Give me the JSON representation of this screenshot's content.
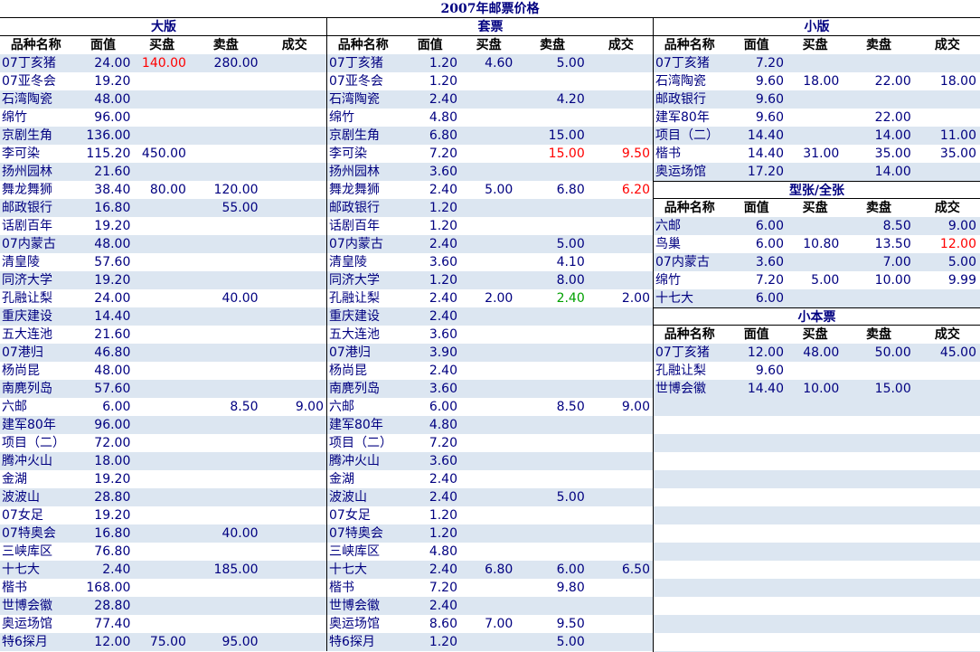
{
  "title": "2007年邮票价格",
  "headers": [
    "品种名称",
    "面值",
    "买盘",
    "卖盘",
    "成交"
  ],
  "sections": {
    "daban": {
      "title": "大版",
      "rows": [
        [
          "07丁亥猪",
          "24.00",
          "140.00",
          "280.00",
          ""
        ],
        [
          "07亚冬会",
          "19.20",
          "",
          "",
          ""
        ],
        [
          "石湾陶瓷",
          "48.00",
          "",
          "",
          ""
        ],
        [
          "绵竹",
          "96.00",
          "",
          "",
          ""
        ],
        [
          "京剧生角",
          "136.00",
          "",
          "",
          ""
        ],
        [
          "李可染",
          "115.20",
          "450.00",
          "",
          ""
        ],
        [
          "扬州园林",
          "21.60",
          "",
          "",
          ""
        ],
        [
          "舞龙舞狮",
          "38.40",
          "80.00",
          "120.00",
          ""
        ],
        [
          "邮政银行",
          "16.80",
          "",
          "55.00",
          ""
        ],
        [
          "话剧百年",
          "19.20",
          "",
          "",
          ""
        ],
        [
          "07内蒙古",
          "48.00",
          "",
          "",
          ""
        ],
        [
          "清皇陵",
          "57.60",
          "",
          "",
          ""
        ],
        [
          "同济大学",
          "19.20",
          "",
          "",
          ""
        ],
        [
          "孔融让梨",
          "24.00",
          "",
          "40.00",
          ""
        ],
        [
          "重庆建设",
          "14.40",
          "",
          "",
          ""
        ],
        [
          "五大连池",
          "21.60",
          "",
          "",
          ""
        ],
        [
          "07港归",
          "46.80",
          "",
          "",
          ""
        ],
        [
          "杨尚昆",
          "48.00",
          "",
          "",
          ""
        ],
        [
          "南麂列岛",
          "57.60",
          "",
          "",
          ""
        ],
        [
          "六邮",
          "6.00",
          "",
          "8.50",
          "9.00"
        ],
        [
          "建军80年",
          "96.00",
          "",
          "",
          ""
        ],
        [
          "项目（二）",
          "72.00",
          "",
          "",
          ""
        ],
        [
          "腾冲火山",
          "18.00",
          "",
          "",
          ""
        ],
        [
          "金湖",
          "19.20",
          "",
          "",
          ""
        ],
        [
          "波波山",
          "28.80",
          "",
          "",
          ""
        ],
        [
          "07女足",
          "19.20",
          "",
          "",
          ""
        ],
        [
          "07特奥会",
          "16.80",
          "",
          "40.00",
          ""
        ],
        [
          "三峡库区",
          "76.80",
          "",
          "",
          ""
        ],
        [
          "十七大",
          "2.40",
          "",
          "185.00",
          ""
        ],
        [
          "楷书",
          "168.00",
          "",
          "",
          ""
        ],
        [
          "世博会徽",
          "28.80",
          "",
          "",
          ""
        ],
        [
          "奥运场馆",
          "77.40",
          "",
          "",
          ""
        ],
        [
          "特6探月",
          "12.00",
          "75.00",
          "95.00",
          ""
        ]
      ]
    },
    "taopiao": {
      "title": "套票",
      "rows": [
        [
          "07丁亥猪",
          "1.20",
          "4.60",
          "5.00",
          ""
        ],
        [
          "07亚冬会",
          "1.20",
          "",
          "",
          ""
        ],
        [
          "石湾陶瓷",
          "2.40",
          "",
          "4.20",
          ""
        ],
        [
          "绵竹",
          "4.80",
          "",
          "",
          ""
        ],
        [
          "京剧生角",
          "6.80",
          "",
          "15.00",
          ""
        ],
        [
          "李可染",
          "7.20",
          "",
          "15.00",
          "9.50"
        ],
        [
          "扬州园林",
          "3.60",
          "",
          "",
          ""
        ],
        [
          "舞龙舞狮",
          "2.40",
          "5.00",
          "6.80",
          "6.20"
        ],
        [
          "邮政银行",
          "1.20",
          "",
          "",
          ""
        ],
        [
          "话剧百年",
          "1.20",
          "",
          "",
          ""
        ],
        [
          "07内蒙古",
          "2.40",
          "",
          "5.00",
          ""
        ],
        [
          "清皇陵",
          "3.60",
          "",
          "4.10",
          ""
        ],
        [
          "同济大学",
          "1.20",
          "",
          "8.00",
          ""
        ],
        [
          "孔融让梨",
          "2.40",
          "2.00",
          "2.40",
          "2.00"
        ],
        [
          "重庆建设",
          "2.40",
          "",
          "",
          ""
        ],
        [
          "五大连池",
          "3.60",
          "",
          "",
          ""
        ],
        [
          "07港归",
          "3.90",
          "",
          "",
          ""
        ],
        [
          "杨尚昆",
          "2.40",
          "",
          "",
          ""
        ],
        [
          "南麂列岛",
          "3.60",
          "",
          "",
          ""
        ],
        [
          "六邮",
          "6.00",
          "",
          "8.50",
          "9.00"
        ],
        [
          "建军80年",
          "4.80",
          "",
          "",
          ""
        ],
        [
          "项目（二）",
          "7.20",
          "",
          "",
          ""
        ],
        [
          "腾冲火山",
          "3.60",
          "",
          "",
          ""
        ],
        [
          "金湖",
          "2.40",
          "",
          "",
          ""
        ],
        [
          "波波山",
          "2.40",
          "",
          "5.00",
          ""
        ],
        [
          "07女足",
          "1.20",
          "",
          "",
          ""
        ],
        [
          "07特奥会",
          "1.20",
          "",
          "",
          ""
        ],
        [
          "三峡库区",
          "4.80",
          "",
          "",
          ""
        ],
        [
          "十七大",
          "2.40",
          "6.80",
          "6.00",
          "6.50"
        ],
        [
          "楷书",
          "7.20",
          "",
          "9.80",
          ""
        ],
        [
          "世博会徽",
          "2.40",
          "",
          "",
          ""
        ],
        [
          "奥运场馆",
          "8.60",
          "7.00",
          "9.50",
          ""
        ],
        [
          "特6探月",
          "1.20",
          "",
          "5.00",
          ""
        ]
      ]
    },
    "xiaoban": {
      "title": "小版",
      "rows": [
        [
          "07丁亥猪",
          "7.20",
          "",
          "",
          ""
        ],
        [
          "石湾陶瓷",
          "9.60",
          "18.00",
          "22.00",
          "18.00"
        ],
        [
          "邮政银行",
          "9.60",
          "",
          "",
          ""
        ],
        [
          "建军80年",
          "9.60",
          "",
          "22.00",
          ""
        ],
        [
          "项目（二）",
          "14.40",
          "",
          "14.00",
          "11.00"
        ],
        [
          "楷书",
          "14.40",
          "31.00",
          "35.00",
          "35.00"
        ],
        [
          "奥运场馆",
          "17.20",
          "",
          "14.00",
          ""
        ]
      ]
    },
    "xingzhang": {
      "title": "型张/全张",
      "rows": [
        [
          "六邮",
          "6.00",
          "",
          "8.50",
          "9.00"
        ],
        [
          "鸟巢",
          "6.00",
          "10.80",
          "13.50",
          "12.00"
        ],
        [
          "07内蒙古",
          "3.60",
          "",
          "7.00",
          "5.00"
        ],
        [
          "绵竹",
          "7.20",
          "5.00",
          "10.00",
          "9.99"
        ],
        [
          "十七大",
          "6.00",
          "",
          "",
          ""
        ]
      ]
    },
    "xiaobenpiao": {
      "title": "小本票",
      "rows": [
        [
          "07丁亥猪",
          "12.00",
          "48.00",
          "50.00",
          "45.00"
        ],
        [
          "孔融让梨",
          "9.60",
          "",
          "",
          ""
        ],
        [
          "世博会徽",
          "14.40",
          "10.00",
          "15.00",
          ""
        ]
      ]
    }
  },
  "highlight_colors": {
    "red": "#ff0000",
    "green": "#00a000"
  }
}
